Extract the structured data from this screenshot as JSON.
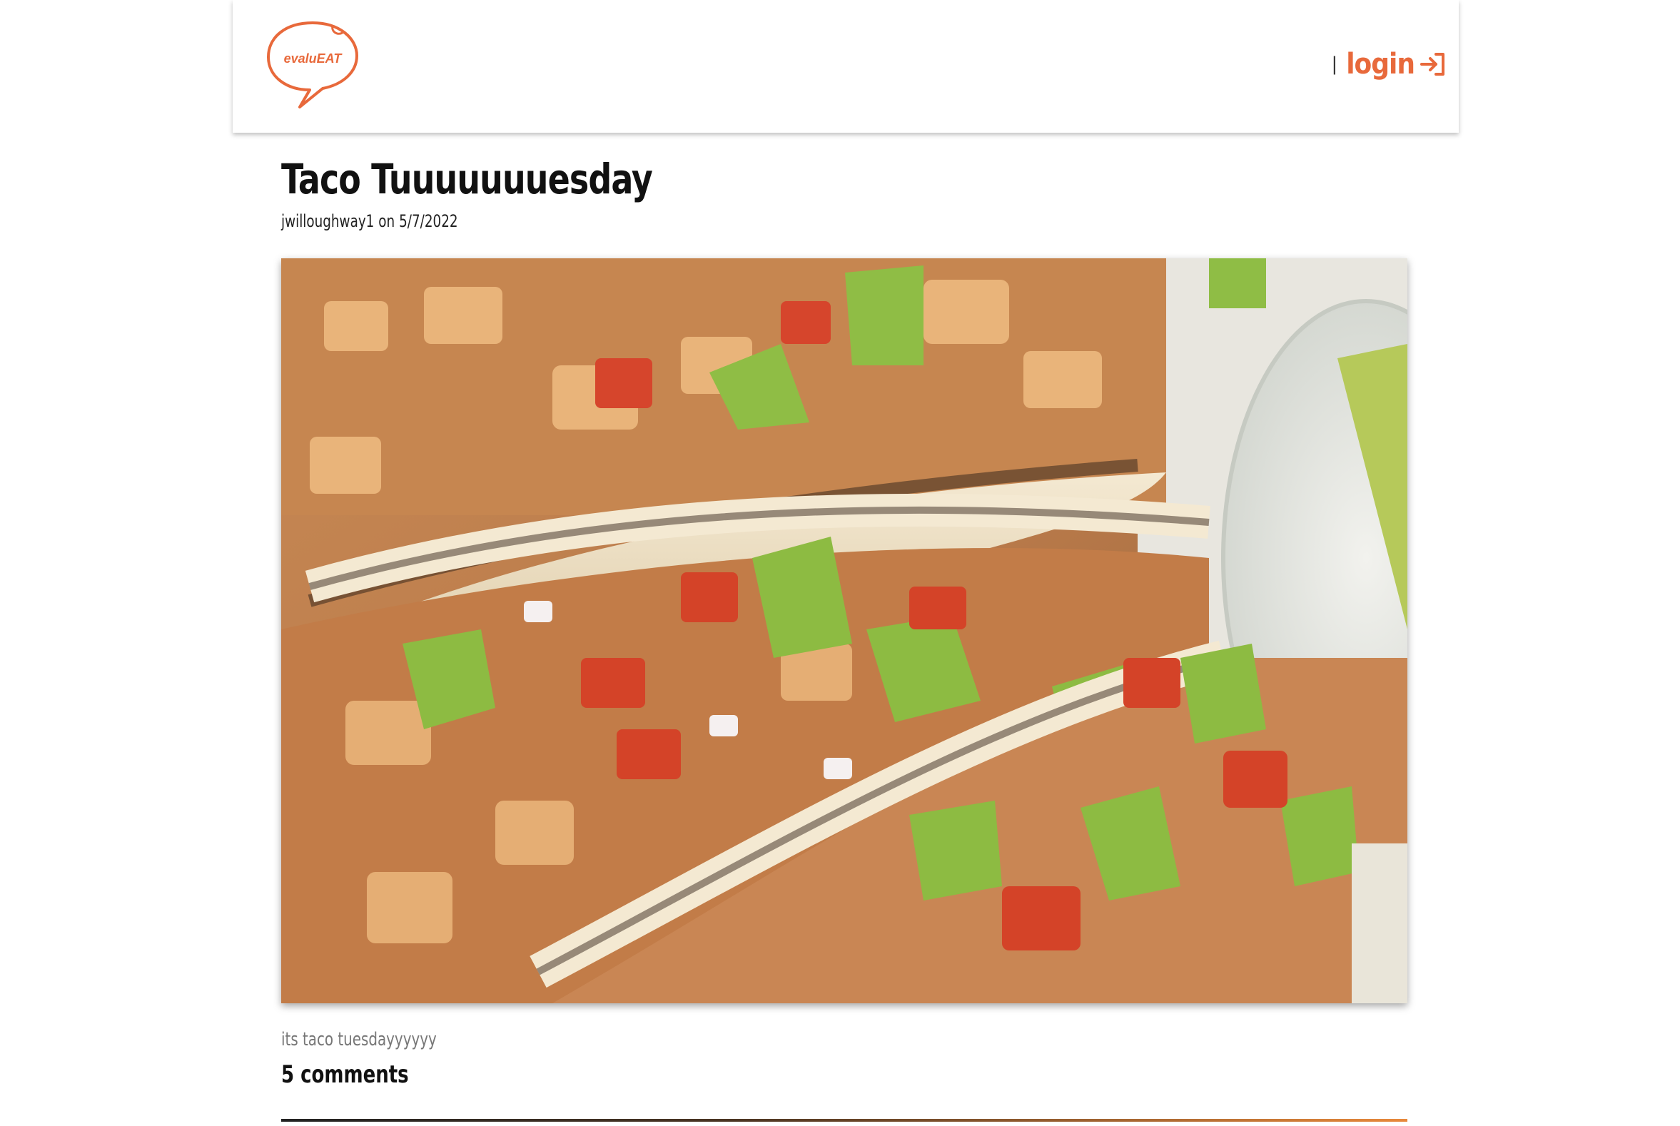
{
  "header": {
    "logo_text": "evaluEAT",
    "divider": "|",
    "login_label": "login"
  },
  "post": {
    "title": "Taco Tuuuuuuuesday",
    "author": "jwilloughway1",
    "on_label": "on",
    "date": "5/7/2022",
    "description": "its taco tuesdayyyyyy",
    "comments_label": "5 comments"
  },
  "colors": {
    "brand": "#e8693b",
    "title": "#111111",
    "description": "#777777"
  },
  "icons": {
    "logo": "speech-bubble-logo",
    "login": "login-arrow-icon"
  }
}
